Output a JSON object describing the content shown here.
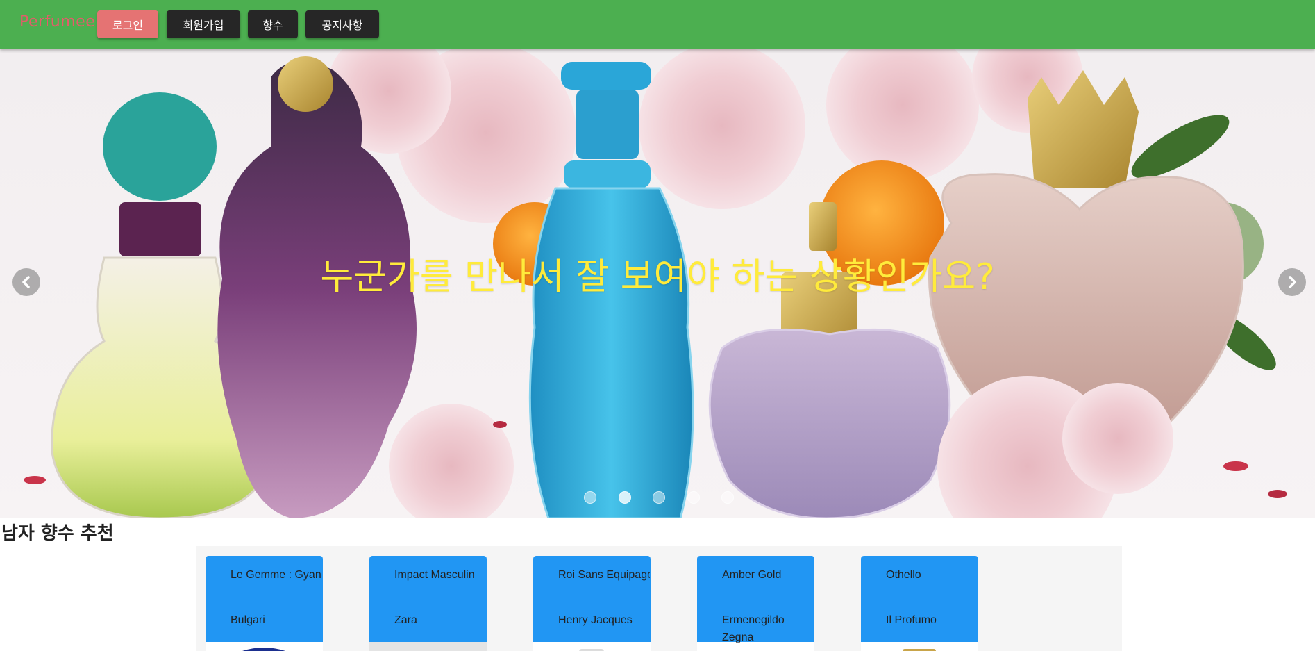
{
  "header": {
    "logo": "Perfumee",
    "nav": {
      "login": "로그인",
      "signup": "회원가입",
      "perfume": "향수",
      "notice": "공지사항"
    }
  },
  "carousel": {
    "caption": "누군가를 만나서 잘 보여야 하는 상황인가요?",
    "prev_icon": "chevron-left-icon",
    "next_icon": "chevron-right-icon",
    "slide_count": 5,
    "active_slide": 2
  },
  "recommend": {
    "title": "남자 향수 추천",
    "cards": [
      {
        "name": "Le Gemme : Gyan",
        "brand": "Bulgari"
      },
      {
        "name": "Impact Masculin",
        "brand": "Zara"
      },
      {
        "name": "Roi Sans Equipage",
        "brand": "Henry Jacques"
      },
      {
        "name": "Amber Gold",
        "brand": "Ermenegildo Zegna"
      },
      {
        "name": "Othello",
        "brand": "Il Profumo"
      }
    ]
  },
  "colors": {
    "header_bg": "#4caf50",
    "logo": "#e35d6a",
    "login_btn": "#e57373",
    "dark_btn": "#262626",
    "caption": "#ffeb3b",
    "card_top": "#2196f3"
  }
}
